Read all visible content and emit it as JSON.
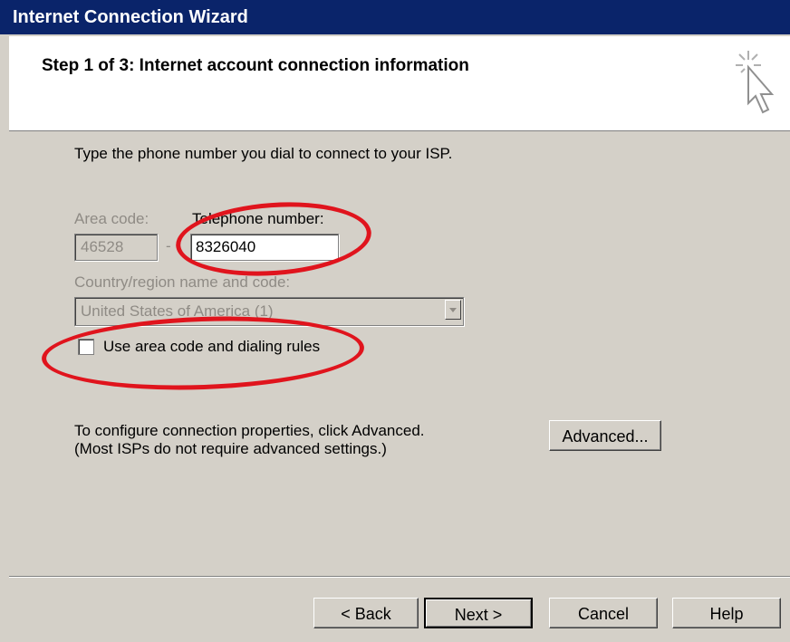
{
  "window": {
    "title": "Internet Connection Wizard"
  },
  "header": {
    "step": "Step 1 of 3: Internet account connection information",
    "icon": "wizard-cursor-icon"
  },
  "main": {
    "instruction": "Type the phone number you dial to connect to your ISP.",
    "area_code_label": "Area code:",
    "area_code_value": "46528",
    "dash": "-",
    "phone_label": "Telephone number:",
    "phone_value": "8326040",
    "country_label": "Country/region name and code:",
    "country_value": "United States of America (1)",
    "checkbox_label": "Use area code and dialing rules",
    "advanced_text_line1": "To configure connection properties, click Advanced.",
    "advanced_text_line2": "(Most ISPs do not require advanced settings.)",
    "advanced_button": "Advanced..."
  },
  "footer": {
    "back": "< Back",
    "next": "Next >",
    "cancel": "Cancel",
    "help": "Help"
  },
  "colors": {
    "titlebar": "#0a246a",
    "annotation": "#e0141d",
    "dialog": "#d4d0c8"
  }
}
